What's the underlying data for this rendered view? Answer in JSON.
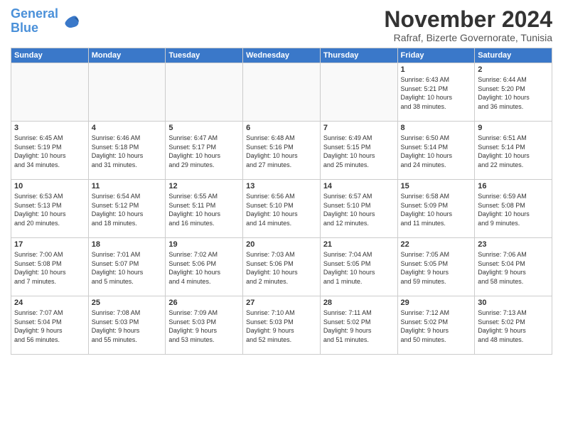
{
  "logo": {
    "line1": "General",
    "line2": "Blue"
  },
  "title": "November 2024",
  "subtitle": "Rafraf, Bizerte Governorate, Tunisia",
  "weekdays": [
    "Sunday",
    "Monday",
    "Tuesday",
    "Wednesday",
    "Thursday",
    "Friday",
    "Saturday"
  ],
  "weeks": [
    [
      {
        "day": "",
        "info": ""
      },
      {
        "day": "",
        "info": ""
      },
      {
        "day": "",
        "info": ""
      },
      {
        "day": "",
        "info": ""
      },
      {
        "day": "",
        "info": ""
      },
      {
        "day": "1",
        "info": "Sunrise: 6:43 AM\nSunset: 5:21 PM\nDaylight: 10 hours\nand 38 minutes."
      },
      {
        "day": "2",
        "info": "Sunrise: 6:44 AM\nSunset: 5:20 PM\nDaylight: 10 hours\nand 36 minutes."
      }
    ],
    [
      {
        "day": "3",
        "info": "Sunrise: 6:45 AM\nSunset: 5:19 PM\nDaylight: 10 hours\nand 34 minutes."
      },
      {
        "day": "4",
        "info": "Sunrise: 6:46 AM\nSunset: 5:18 PM\nDaylight: 10 hours\nand 31 minutes."
      },
      {
        "day": "5",
        "info": "Sunrise: 6:47 AM\nSunset: 5:17 PM\nDaylight: 10 hours\nand 29 minutes."
      },
      {
        "day": "6",
        "info": "Sunrise: 6:48 AM\nSunset: 5:16 PM\nDaylight: 10 hours\nand 27 minutes."
      },
      {
        "day": "7",
        "info": "Sunrise: 6:49 AM\nSunset: 5:15 PM\nDaylight: 10 hours\nand 25 minutes."
      },
      {
        "day": "8",
        "info": "Sunrise: 6:50 AM\nSunset: 5:14 PM\nDaylight: 10 hours\nand 24 minutes."
      },
      {
        "day": "9",
        "info": "Sunrise: 6:51 AM\nSunset: 5:14 PM\nDaylight: 10 hours\nand 22 minutes."
      }
    ],
    [
      {
        "day": "10",
        "info": "Sunrise: 6:53 AM\nSunset: 5:13 PM\nDaylight: 10 hours\nand 20 minutes."
      },
      {
        "day": "11",
        "info": "Sunrise: 6:54 AM\nSunset: 5:12 PM\nDaylight: 10 hours\nand 18 minutes."
      },
      {
        "day": "12",
        "info": "Sunrise: 6:55 AM\nSunset: 5:11 PM\nDaylight: 10 hours\nand 16 minutes."
      },
      {
        "day": "13",
        "info": "Sunrise: 6:56 AM\nSunset: 5:10 PM\nDaylight: 10 hours\nand 14 minutes."
      },
      {
        "day": "14",
        "info": "Sunrise: 6:57 AM\nSunset: 5:10 PM\nDaylight: 10 hours\nand 12 minutes."
      },
      {
        "day": "15",
        "info": "Sunrise: 6:58 AM\nSunset: 5:09 PM\nDaylight: 10 hours\nand 11 minutes."
      },
      {
        "day": "16",
        "info": "Sunrise: 6:59 AM\nSunset: 5:08 PM\nDaylight: 10 hours\nand 9 minutes."
      }
    ],
    [
      {
        "day": "17",
        "info": "Sunrise: 7:00 AM\nSunset: 5:08 PM\nDaylight: 10 hours\nand 7 minutes."
      },
      {
        "day": "18",
        "info": "Sunrise: 7:01 AM\nSunset: 5:07 PM\nDaylight: 10 hours\nand 5 minutes."
      },
      {
        "day": "19",
        "info": "Sunrise: 7:02 AM\nSunset: 5:06 PM\nDaylight: 10 hours\nand 4 minutes."
      },
      {
        "day": "20",
        "info": "Sunrise: 7:03 AM\nSunset: 5:06 PM\nDaylight: 10 hours\nand 2 minutes."
      },
      {
        "day": "21",
        "info": "Sunrise: 7:04 AM\nSunset: 5:05 PM\nDaylight: 10 hours\nand 1 minute."
      },
      {
        "day": "22",
        "info": "Sunrise: 7:05 AM\nSunset: 5:05 PM\nDaylight: 9 hours\nand 59 minutes."
      },
      {
        "day": "23",
        "info": "Sunrise: 7:06 AM\nSunset: 5:04 PM\nDaylight: 9 hours\nand 58 minutes."
      }
    ],
    [
      {
        "day": "24",
        "info": "Sunrise: 7:07 AM\nSunset: 5:04 PM\nDaylight: 9 hours\nand 56 minutes."
      },
      {
        "day": "25",
        "info": "Sunrise: 7:08 AM\nSunset: 5:03 PM\nDaylight: 9 hours\nand 55 minutes."
      },
      {
        "day": "26",
        "info": "Sunrise: 7:09 AM\nSunset: 5:03 PM\nDaylight: 9 hours\nand 53 minutes."
      },
      {
        "day": "27",
        "info": "Sunrise: 7:10 AM\nSunset: 5:03 PM\nDaylight: 9 hours\nand 52 minutes."
      },
      {
        "day": "28",
        "info": "Sunrise: 7:11 AM\nSunset: 5:02 PM\nDaylight: 9 hours\nand 51 minutes."
      },
      {
        "day": "29",
        "info": "Sunrise: 7:12 AM\nSunset: 5:02 PM\nDaylight: 9 hours\nand 50 minutes."
      },
      {
        "day": "30",
        "info": "Sunrise: 7:13 AM\nSunset: 5:02 PM\nDaylight: 9 hours\nand 48 minutes."
      }
    ]
  ]
}
